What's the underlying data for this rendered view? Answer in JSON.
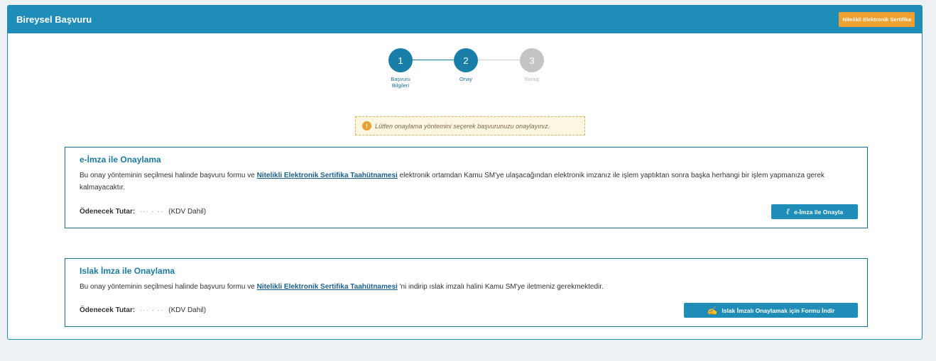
{
  "header": {
    "title": "Bireysel Başvuru",
    "cert_badge": "Nitelikli Elektronik Sertifika",
    "color": "#1e8db8",
    "badge_color": "#f0a030"
  },
  "stepper": {
    "steps": [
      {
        "number": "1",
        "label_line1": "Başvuru",
        "label_line2": "Bilgileri",
        "state": "done",
        "color": "#1a7fa8"
      },
      {
        "number": "2",
        "label_line1": "Onay",
        "label_line2": "",
        "state": "active",
        "color": "#1a7fa8"
      },
      {
        "number": "3",
        "label_line1": "Sonuç",
        "label_line2": "",
        "state": "pending",
        "color": "#c4c4c4"
      }
    ]
  },
  "notice": {
    "icon": "warning-icon",
    "text": "Lütfen onaylama yöntemini seçerek başvurunuzu onaylayınız."
  },
  "eimza": {
    "title": "e-İmza ile Onaylama",
    "desc_before": "Bu onay yönteminin seçilmesi halinde başvuru formu ve ",
    "link": "Nitelikli Elektronik Sertifika Taahütnamesi",
    "desc_after": " elektronik ortamdan Kamu SM'ye ulaşacağından elektronik imzanız ile işlem yaptıktan sonra başka herhangi bir işlem yapmanıza gerek kalmayacaktır.",
    "amount_label": "Ödenecek Tutar:",
    "amount_value": "··· · ··",
    "amount_suffix": "(KDV Dahil)",
    "button_icon": "e-signature-icon",
    "button_label": "e-İmza ile Onayla"
  },
  "islak": {
    "title": "Islak İmza ile Onaylama",
    "desc_before": "Bu onay yönteminin seçilmesi halinde başvuru formu ve ",
    "link": "Nitelikli Elektronik Sertifika Taahütnamesi",
    "desc_after": " 'ni indirip ıslak imzalı halini Kamu SM'ye iletmeniz gerekmektedir.",
    "amount_label": "Ödenecek Tutar:",
    "amount_value": "··· · ··",
    "amount_suffix": "(KDV Dahil)",
    "button_icon": "wet-signature-icon",
    "button_label": "Islak İmzalı Onaylamak için Formu İndir"
  }
}
